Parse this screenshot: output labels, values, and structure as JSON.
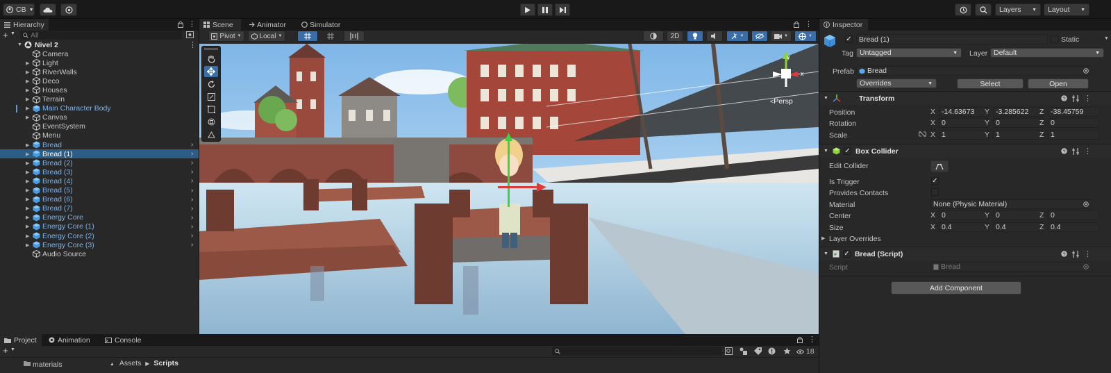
{
  "toolbar": {
    "account_label": "CB",
    "layers_label": "Layers",
    "layout_label": "Layout"
  },
  "hierarchy": {
    "tab_label": "Hierarchy",
    "search_placeholder": "All",
    "scene_name": "Nivel 2",
    "items": [
      {
        "label": "Camera",
        "prefab": false,
        "arrow": false,
        "chevron": false
      },
      {
        "label": "Light",
        "prefab": false,
        "arrow": true,
        "chevron": false
      },
      {
        "label": "RiverWalls",
        "prefab": false,
        "arrow": true,
        "chevron": false
      },
      {
        "label": "Deco",
        "prefab": false,
        "arrow": true,
        "chevron": false
      },
      {
        "label": "Houses",
        "prefab": false,
        "arrow": true,
        "chevron": false
      },
      {
        "label": "Terrain",
        "prefab": false,
        "arrow": true,
        "chevron": false
      },
      {
        "label": "Main Character Body",
        "prefab": true,
        "arrow": true,
        "chevron": false
      },
      {
        "label": "Canvas",
        "prefab": false,
        "arrow": true,
        "chevron": false
      },
      {
        "label": "EventSystem",
        "prefab": false,
        "arrow": false,
        "chevron": false
      },
      {
        "label": "Menu",
        "prefab": false,
        "arrow": false,
        "chevron": false
      },
      {
        "label": "Bread",
        "prefab": true,
        "arrow": true,
        "chevron": true
      },
      {
        "label": "Bread (1)",
        "prefab": true,
        "arrow": true,
        "chevron": true,
        "selected": true
      },
      {
        "label": "Bread (2)",
        "prefab": true,
        "arrow": true,
        "chevron": true
      },
      {
        "label": "Bread (3)",
        "prefab": true,
        "arrow": true,
        "chevron": true
      },
      {
        "label": "Bread (4)",
        "prefab": true,
        "arrow": true,
        "chevron": true
      },
      {
        "label": "Bread (5)",
        "prefab": true,
        "arrow": true,
        "chevron": true
      },
      {
        "label": "Bread (6)",
        "prefab": true,
        "arrow": true,
        "chevron": true
      },
      {
        "label": "Bread (7)",
        "prefab": true,
        "arrow": true,
        "chevron": true
      },
      {
        "label": "Energy Core",
        "prefab": true,
        "arrow": true,
        "chevron": true
      },
      {
        "label": "Energy Core (1)",
        "prefab": true,
        "arrow": true,
        "chevron": true
      },
      {
        "label": "Energy Core (2)",
        "prefab": true,
        "arrow": true,
        "chevron": true
      },
      {
        "label": "Energy Core (3)",
        "prefab": true,
        "arrow": true,
        "chevron": true
      },
      {
        "label": "Audio Source",
        "prefab": false,
        "arrow": false,
        "chevron": false
      }
    ]
  },
  "scene": {
    "tabs": [
      "Scene",
      "Animator",
      "Simulator"
    ],
    "pivot_label": "Pivot",
    "local_label": "Local",
    "mode_2d_label": "2D",
    "persp_label": "Persp"
  },
  "inspector": {
    "tab_label": "Inspector",
    "object_name": "Bread (1)",
    "static_label": "Static",
    "tag_label": "Tag",
    "tag_value": "Untagged",
    "layer_label": "Layer",
    "layer_value": "Default",
    "prefab_label": "Prefab",
    "prefab_value": "Bread",
    "overrides_label": "Overrides",
    "select_label": "Select",
    "open_label": "Open",
    "transform": {
      "title": "Transform",
      "position_label": "Position",
      "rotation_label": "Rotation",
      "scale_label": "Scale",
      "position": [
        "-14.63673",
        "-3.285622",
        "-38.45759"
      ],
      "rotation": [
        "0",
        "0",
        "0"
      ],
      "scale": [
        "1",
        "1",
        "1"
      ]
    },
    "box_collider": {
      "title": "Box Collider",
      "edit_collider_label": "Edit Collider",
      "is_trigger_label": "Is Trigger",
      "provides_contacts_label": "Provides Contacts",
      "material_label": "Material",
      "material_value": "None (Physic Material)",
      "center_label": "Center",
      "size_label": "Size",
      "center": [
        "0",
        "0",
        "0"
      ],
      "size": [
        "0.4",
        "0.4",
        "0.4"
      ],
      "layer_overrides_label": "Layer Overrides"
    },
    "script_component": {
      "title": "Bread (Script)",
      "script_label": "Script",
      "script_value": "Bread"
    },
    "add_component_label": "Add Component",
    "axis_labels": [
      "X",
      "Y",
      "Z"
    ]
  },
  "bottom": {
    "tabs": [
      "Project",
      "Animation",
      "Console"
    ],
    "breadcrumb_root": "Assets",
    "breadcrumb_current": "Scripts",
    "folder_label": "materials",
    "badge_count": "18"
  },
  "colors": {
    "selection": "#2c5d87",
    "prefab_text": "#7fb2e6",
    "panel_bg": "#282828"
  }
}
